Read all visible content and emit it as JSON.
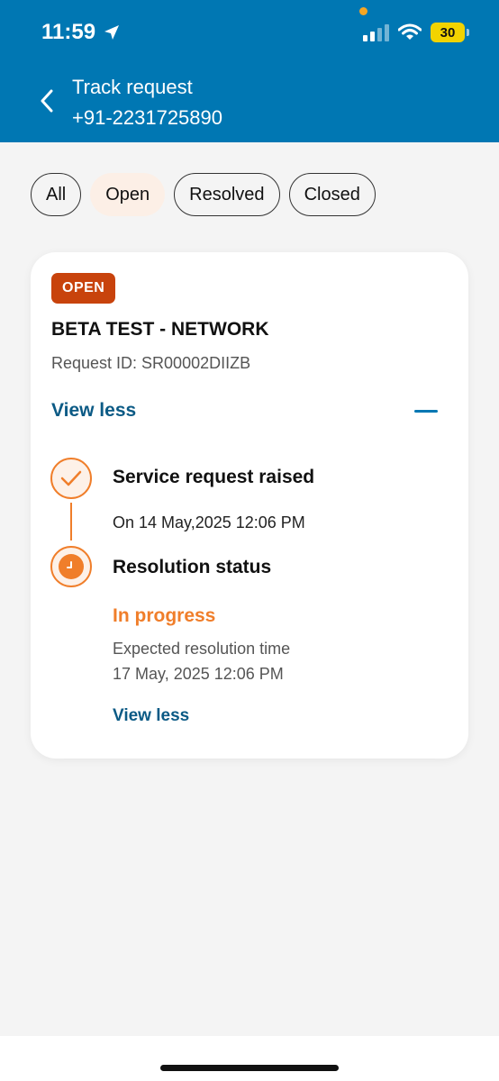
{
  "status_bar": {
    "time": "11:59",
    "battery": "30",
    "icons": [
      "location-arrow-icon",
      "signal-icon",
      "wifi-icon",
      "battery-icon"
    ]
  },
  "header": {
    "title": "Track request",
    "subtitle": "+91-2231725890",
    "back_icon": "chevron-left-icon",
    "background_color": "#0077b3"
  },
  "filters": {
    "items": [
      "All",
      "Open",
      "Resolved",
      "Closed"
    ],
    "selected": "Open"
  },
  "request_card": {
    "status_badge": "OPEN",
    "title": "BETA TEST - NETWORK",
    "request_id": "Request ID: SR00002DIIZB",
    "toggle_label": "View less",
    "toggle_icon": "minus-icon",
    "steps": [
      {
        "icon": "check-icon",
        "title": "Service request raised",
        "detail": "On 14 May,2025 12:06 PM"
      },
      {
        "icon": "clock-icon",
        "title": "Resolution status",
        "status": "In progress",
        "expected_label": "Expected resolution time",
        "expected_time": "17 May, 2025 12:06 PM",
        "link": "View less"
      }
    ],
    "colors": {
      "badge": "#c8430c",
      "accent": "#f07e2a",
      "link": "#0b5a85"
    }
  }
}
